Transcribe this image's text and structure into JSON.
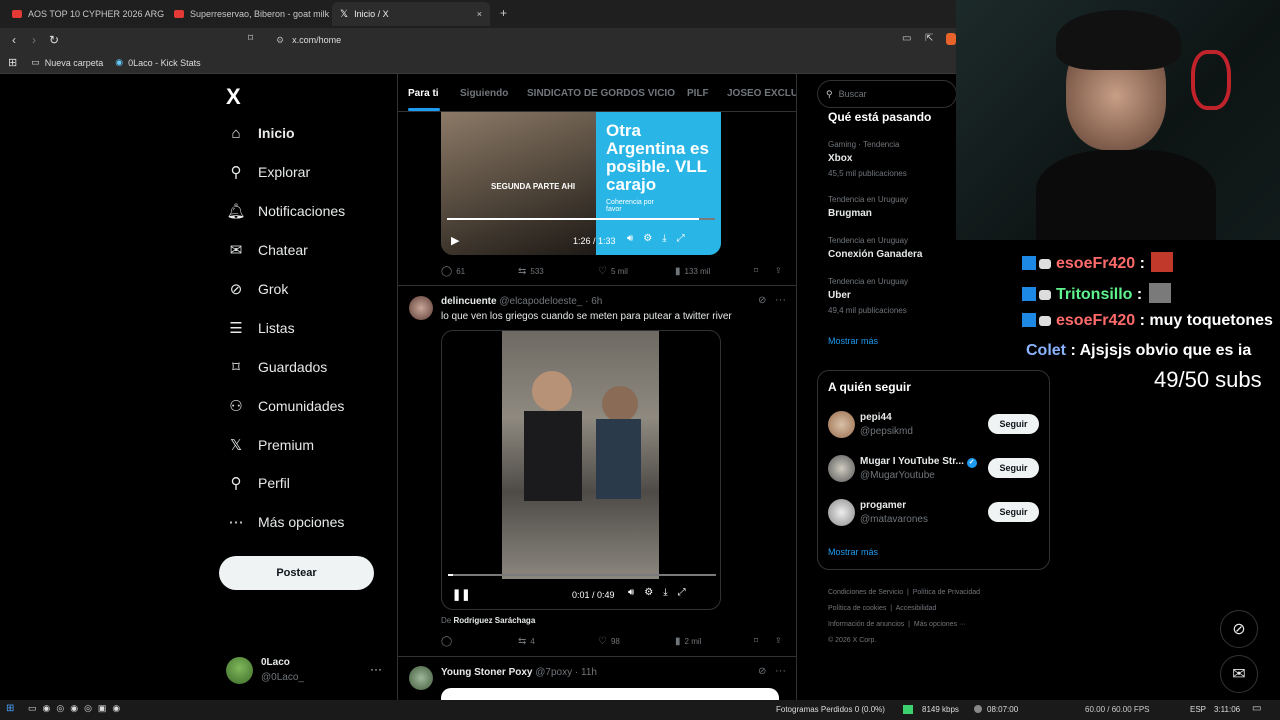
{
  "browser": {
    "tabs": [
      {
        "label": "AOS TOP 10 CYPHER 2026 ARG - You"
      },
      {
        "label": "Superreservao, Biberon - goat milk"
      },
      {
        "label": "Inicio / X",
        "close": "×"
      }
    ],
    "new_tab": "+",
    "url": "x.com/home",
    "bookmarks": [
      {
        "label": "Nueva carpeta"
      },
      {
        "label": "0Laco - Kick Stats"
      }
    ]
  },
  "sidebar": {
    "logo": "X",
    "items": [
      {
        "label": "Inicio",
        "icon": "home-icon",
        "glyph": "⌂"
      },
      {
        "label": "Explorar",
        "icon": "search-icon",
        "glyph": "⚲"
      },
      {
        "label": "Notificaciones",
        "icon": "bell-icon",
        "glyph": "🔔︎"
      },
      {
        "label": "Chatear",
        "icon": "mail-icon",
        "glyph": "✉"
      },
      {
        "label": "Grok",
        "icon": "grok-icon",
        "glyph": "⊘"
      },
      {
        "label": "Listas",
        "icon": "list-icon",
        "glyph": "☰"
      },
      {
        "label": "Guardados",
        "icon": "bookmark-icon",
        "glyph": "⌑"
      },
      {
        "label": "Comunidades",
        "icon": "communities-icon",
        "glyph": "⚇"
      },
      {
        "label": "Premium",
        "icon": "x-icon",
        "glyph": "𝕏"
      },
      {
        "label": "Perfil",
        "icon": "user-icon",
        "glyph": "⚲"
      },
      {
        "label": "Más opciones",
        "icon": "more-circle-icon",
        "glyph": "⋯"
      }
    ],
    "post_button": "Postear",
    "account": {
      "name": "0Laco",
      "handle": "@0Laco_",
      "more": "···"
    }
  },
  "feed": {
    "tabs": [
      "Para ti",
      "Siguiendo",
      "SINDICATO DE GORDOS VICIO",
      "PILF",
      "JOSEO EXCLUSI"
    ],
    "post1": {
      "video_text": {
        "overlay": "SEGUNDA PARTE AHI",
        "headline": "Otra Argentina es posible. VLL carajo",
        "sub": "Coherencia por favor"
      },
      "time": "1:26 / 1:33",
      "progress": 0.94,
      "replies": "61",
      "reposts": "533",
      "likes": "5 mil",
      "views": "133 mil"
    },
    "post2": {
      "name": "delincuente",
      "handle": "@elcapodeloeste_",
      "dot_time": "· 6h",
      "text": "lo que ven los griegos cuando se meten para putear a twitter river",
      "time": "0:01 / 0:49",
      "progress": 0.02,
      "from_prefix": "De",
      "from_name": "Rodriguez Saráchaga",
      "replies": "",
      "reposts": "4",
      "likes": "98",
      "views": "2 mil"
    },
    "post3": {
      "name": "Young Stoner Poxy",
      "handle": "@7poxy",
      "dot_time": "· 11h"
    }
  },
  "right": {
    "search_placeholder": "Buscar",
    "trends_title": "Qué está pasando",
    "trends": [
      {
        "meta": "Gaming · Tendencia",
        "name": "Xbox",
        "count": "45,5 mil publicaciones"
      },
      {
        "meta": "Tendencia en Uruguay",
        "name": "Brugman",
        "count": ""
      },
      {
        "meta": "Tendencia en Uruguay",
        "name": "Conexión Ganadera",
        "count": ""
      },
      {
        "meta": "Tendencia en Uruguay",
        "name": "Uber",
        "count": "49,4 mil publicaciones"
      }
    ],
    "show_more": "Mostrar más",
    "follow_title": "A quién seguir",
    "follow": [
      {
        "name": "pepi44",
        "handle": "@pepsikmd",
        "button": "Seguir"
      },
      {
        "name": "Mugar I YouTube Str...",
        "handle": "@MugarYoutube",
        "button": "Seguir",
        "verified": true
      },
      {
        "name": "progamer",
        "handle": "@matavarones",
        "button": "Seguir"
      }
    ],
    "show_more2": "Mostrar más",
    "footer": [
      "Condiciones de Servicio",
      "Política de Privacidad",
      "Política de cookies",
      "Accesibilidad",
      "Información de anuncios",
      "Más opciones ···",
      "© 2026 X Corp."
    ]
  },
  "stream": {
    "chat": [
      {
        "user": "esoeFr420",
        "sep": " : ",
        "msg": "",
        "color": "#ff6b6b"
      },
      {
        "user": "Tritonsillo",
        "sep": " : ",
        "msg": "",
        "color": "#5ef38c"
      },
      {
        "user": "esoeFr420",
        "sep": " : ",
        "msg": "muy toquetones",
        "color": "#ff6b6b"
      },
      {
        "user": "Colet",
        "sep": " : ",
        "msg": "Ajsjsjs obvio que es ia",
        "color": "#8ab4ff"
      }
    ],
    "subs": "49/50 subs"
  },
  "taskbar": {
    "frames": "Fotogramas Perdidos 0 (0.0%)",
    "bitrate": "8149 kbps",
    "rec": "08:07:00",
    "fps": "60.00 / 60.00 FPS",
    "lang": "ESP",
    "clock": "3:11:06"
  },
  "colors": {
    "accent": "#1d9bf0",
    "bg": "#000000",
    "border": "#2f3336"
  }
}
